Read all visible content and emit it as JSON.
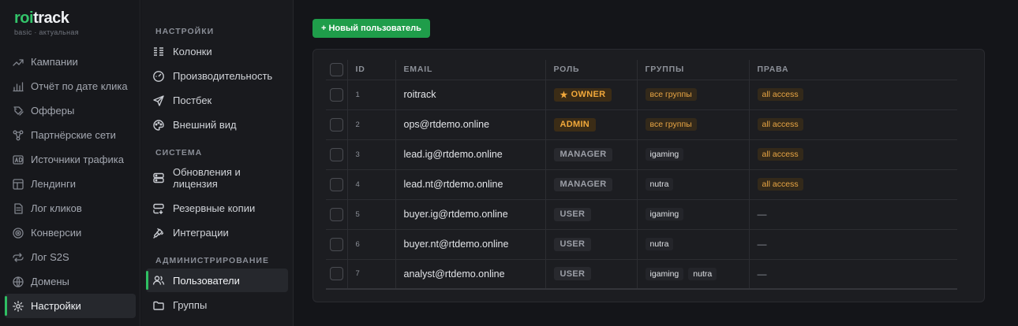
{
  "brand": {
    "logo_accent": "roi",
    "logo_rest": "track",
    "plan": "basic",
    "plan_status": "актуальная",
    "accent_color": "#2fbf63"
  },
  "sidebar": {
    "items": [
      {
        "label": "Кампании",
        "icon": "trend-icon"
      },
      {
        "label": "Отчёт по дате клика",
        "icon": "bar-chart-icon"
      },
      {
        "label": "Офферы",
        "icon": "offers-icon"
      },
      {
        "label": "Партнёрские сети",
        "icon": "network-icon"
      },
      {
        "label": "Источники трафика",
        "icon": "ad-icon"
      },
      {
        "label": "Лендинги",
        "icon": "layout-icon"
      },
      {
        "label": "Лог кликов",
        "icon": "log-icon"
      },
      {
        "label": "Конверсии",
        "icon": "target-icon"
      },
      {
        "label": "Лог S2S",
        "icon": "s2s-icon"
      },
      {
        "label": "Домены",
        "icon": "globe-icon"
      },
      {
        "label": "Настройки",
        "icon": "gear-icon",
        "active": true
      }
    ]
  },
  "subnav": {
    "sections": [
      {
        "title": "НАСТРОЙКИ",
        "items": [
          {
            "label": "Колонки",
            "icon": "columns-icon"
          },
          {
            "label": "Производительность",
            "icon": "gauge-icon"
          },
          {
            "label": "Постбек",
            "icon": "send-icon"
          },
          {
            "label": "Внешний вид",
            "icon": "palette-icon"
          }
        ]
      },
      {
        "title": "СИСТЕМА",
        "items": [
          {
            "label": "Обновления и лицензия",
            "line1": "Обновления и",
            "line2": "лицензия",
            "icon": "server-icon"
          },
          {
            "label": "Резервные копии",
            "icon": "backup-icon"
          },
          {
            "label": "Интеграции",
            "icon": "plug-icon"
          }
        ]
      },
      {
        "title": "АДМИНИСТРИРОВАНИЕ",
        "items": [
          {
            "label": "Пользователи",
            "icon": "users-icon",
            "active": true
          },
          {
            "label": "Группы",
            "icon": "folder-icon"
          }
        ]
      }
    ]
  },
  "main": {
    "new_user_button": "+ Новый пользователь",
    "table": {
      "headers": [
        "ID",
        "EMAIL",
        "РОЛЬ",
        "ГРУППЫ",
        "ПРАВА"
      ],
      "rows": [
        {
          "id": "1",
          "email": "roitrack",
          "role": "OWNER",
          "role_star": "★",
          "groups": [
            "все группы"
          ],
          "rights": "all access"
        },
        {
          "id": "2",
          "email": "ops@rtdemo.online",
          "role": "ADMIN",
          "groups": [
            "все группы"
          ],
          "rights": "all access"
        },
        {
          "id": "3",
          "email": "lead.ig@rtdemo.online",
          "role": "MANAGER",
          "groups": [
            "igaming"
          ],
          "rights": "all access"
        },
        {
          "id": "4",
          "email": "lead.nt@rtdemo.online",
          "role": "MANAGER",
          "groups": [
            "nutra"
          ],
          "rights": "all access"
        },
        {
          "id": "5",
          "email": "buyer.ig@rtdemo.online",
          "role": "USER",
          "groups": [
            "igaming"
          ],
          "rights": "—"
        },
        {
          "id": "6",
          "email": "buyer.nt@rtdemo.online",
          "role": "USER",
          "groups": [
            "nutra"
          ],
          "rights": "—"
        },
        {
          "id": "7",
          "email": "analyst@rtdemo.online",
          "role": "USER",
          "groups": [
            "igaming",
            "nutra"
          ],
          "rights": "—"
        }
      ]
    }
  }
}
